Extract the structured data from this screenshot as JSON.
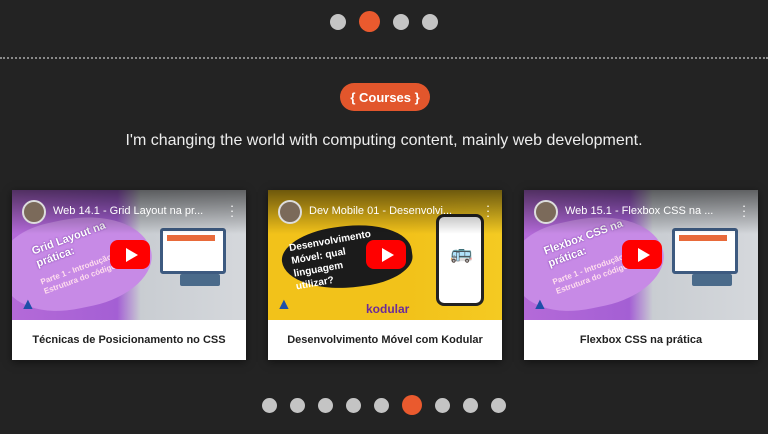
{
  "top_carousel": {
    "dots": 4,
    "active_index": 1
  },
  "section": {
    "badge": "{ Courses }",
    "subtitle": "I'm changing the world with computing content, mainly web development."
  },
  "cards": [
    {
      "video_title": "Web 14.1 - Grid Layout na pr...",
      "caption": "Técnicas de Posicionamento no CSS",
      "theme": "purple",
      "thumb_text": "Grid Layout na prática:",
      "thumb_sub": "Parte 1 - Introdução Estrutura do código"
    },
    {
      "video_title": "Dev Mobile 01 - Desenvolvi...",
      "caption": "Desenvolvimento Móvel com Kodular",
      "theme": "yellow",
      "thumb_text": "Desenvolvimento Móvel: qual linguagem utilizar?",
      "thumb_sub": "kodular"
    },
    {
      "video_title": "Web 15.1 - Flexbox CSS na ...",
      "caption": "Flexbox CSS na prática",
      "theme": "purple",
      "thumb_text": "Flexbox CSS na prática:",
      "thumb_sub": "Parte 1 - Introdução Estrutura do código"
    }
  ],
  "bottom_carousel": {
    "dots": 9,
    "active_index": 5
  },
  "colors": {
    "accent": "#e2562c",
    "background": "#232323",
    "dot": "#c4c4c4"
  }
}
